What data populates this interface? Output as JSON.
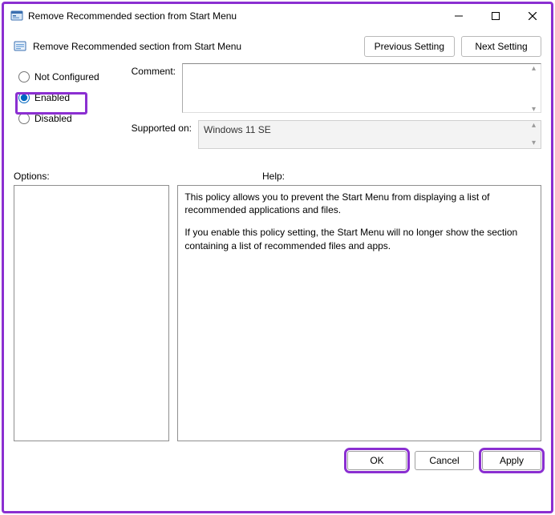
{
  "window": {
    "title": "Remove Recommended section from Start Menu"
  },
  "header": {
    "policy_name": "Remove Recommended section from Start Menu",
    "previous_setting_label": "Previous Setting",
    "next_setting_label": "Next Setting"
  },
  "state": {
    "options": {
      "not_configured": "Not Configured",
      "enabled": "Enabled",
      "disabled": "Disabled"
    },
    "selected": "enabled"
  },
  "fields": {
    "comment_label": "Comment:",
    "comment_value": "",
    "supported_label": "Supported on:",
    "supported_value": "Windows 11 SE"
  },
  "labels": {
    "options": "Options:",
    "help": "Help:"
  },
  "help": {
    "para1": "This policy allows you to prevent the Start Menu from displaying a list of recommended applications and files.",
    "para2": "If you enable this policy setting, the Start Menu will no longer show the section containing a list of recommended files and apps."
  },
  "footer": {
    "ok": "OK",
    "cancel": "Cancel",
    "apply": "Apply"
  },
  "highlights": {
    "enabled_radio": true,
    "ok_button": true,
    "apply_button": true
  }
}
